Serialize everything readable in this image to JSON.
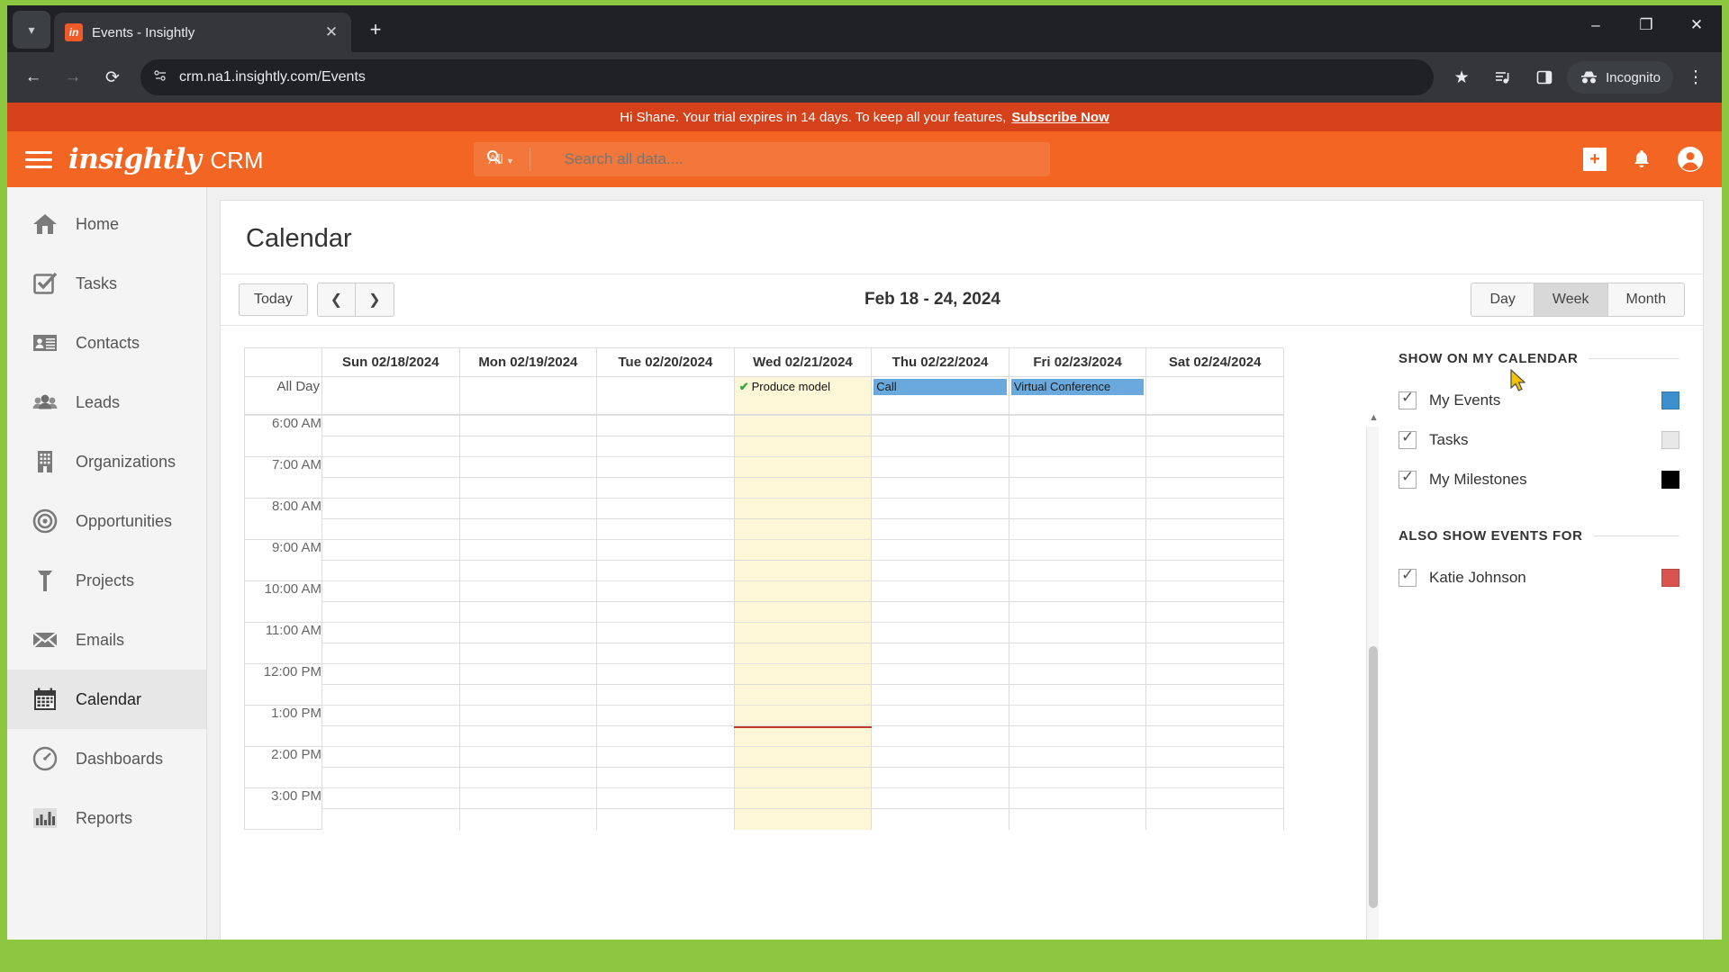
{
  "browser": {
    "tab": {
      "title": "Events - Insightly",
      "favicon_icon": "insightly-favicon",
      "close_icon": "close-icon"
    },
    "new_tab_label": "+",
    "tab_search_icon": "chevron-down-icon",
    "window_controls": {
      "minimize": "–",
      "maximize": "❐",
      "close": "✕"
    },
    "nav": {
      "back": "←",
      "forward": "→",
      "reload": "⟳"
    },
    "url": "crm.na1.insightly.com/Events",
    "site_settings_icon": "site-settings-icon",
    "bookmark_icon": "★",
    "reading_list_icon": "reading-list-icon",
    "side_panel_icon": "side-panel-icon",
    "incognito_label": "Incognito",
    "menu_icon": "⋮"
  },
  "banner": {
    "text": "Hi Shane. Your trial expires in 14 days. To keep all your features,",
    "link": "Subscribe Now"
  },
  "appheader": {
    "logo": "insightly",
    "product": "CRM",
    "search": {
      "scope": "All",
      "placeholder": "Search all data...."
    },
    "add_icon": "plus-icon",
    "bell_icon": "bell-icon",
    "account_icon": "account-icon"
  },
  "sidebar": {
    "items": [
      {
        "label": "Home",
        "icon": "home-icon",
        "active": false
      },
      {
        "label": "Tasks",
        "icon": "task-check-icon",
        "active": false
      },
      {
        "label": "Contacts",
        "icon": "contact-card-icon",
        "active": false
      },
      {
        "label": "Leads",
        "icon": "people-icon",
        "active": false
      },
      {
        "label": "Organizations",
        "icon": "building-icon",
        "active": false
      },
      {
        "label": "Opportunities",
        "icon": "target-icon",
        "active": false
      },
      {
        "label": "Projects",
        "icon": "hammer-icon",
        "active": false
      },
      {
        "label": "Emails",
        "icon": "envelope-icon",
        "active": false
      },
      {
        "label": "Calendar",
        "icon": "calendar-icon",
        "active": true
      },
      {
        "label": "Dashboards",
        "icon": "gauge-icon",
        "active": false
      },
      {
        "label": "Reports",
        "icon": "bar-chart-icon",
        "active": false
      }
    ]
  },
  "calendar": {
    "page_title": "Calendar",
    "toolbar": {
      "today_label": "Today",
      "prev_label": "❮",
      "next_label": "❯",
      "range_label": "Feb 18 - 24, 2024",
      "views": [
        {
          "label": "Day",
          "selected": false
        },
        {
          "label": "Week",
          "selected": true
        },
        {
          "label": "Month",
          "selected": false
        }
      ]
    },
    "all_day_label": "All Day",
    "columns": [
      "Sun 02/18/2024",
      "Mon 02/19/2024",
      "Tue 02/20/2024",
      "Wed 02/21/2024",
      "Thu 02/22/2024",
      "Fri 02/23/2024",
      "Sat 02/24/2024"
    ],
    "today_column_index": 3,
    "all_day_events": [
      {
        "column": 3,
        "title": "Produce model",
        "style": "task",
        "icon": "green-check-icon"
      },
      {
        "column": 4,
        "title": "Call",
        "style": "blue"
      },
      {
        "column": 5,
        "title": "Virtual Conference",
        "style": "blue"
      }
    ],
    "time_labels": [
      "6:00 AM",
      "7:00 AM",
      "8:00 AM",
      "9:00 AM",
      "10:00 AM",
      "11:00 AM",
      "12:00 PM",
      "1:00 PM",
      "2:00 PM",
      "3:00 PM"
    ],
    "now_marker": {
      "color": "#c0392b",
      "after_label": "1:00 PM"
    }
  },
  "rail": {
    "section1_title": "SHOW ON MY CALENDAR",
    "section1_items": [
      {
        "label": "My Events",
        "checked": true,
        "color": "#3d8ecd"
      },
      {
        "label": "Tasks",
        "checked": true,
        "color": "#e8e8e8"
      },
      {
        "label": "My Milestones",
        "checked": true,
        "color": "#000000"
      }
    ],
    "section2_title": "ALSO SHOW EVENTS FOR",
    "section2_items": [
      {
        "label": "Katie Johnson",
        "checked": true,
        "color": "#d9534f"
      }
    ]
  },
  "theme": {
    "brand_orange": "#f26522",
    "banner_red": "#d4411b",
    "frame_green": "#8dc63f"
  }
}
